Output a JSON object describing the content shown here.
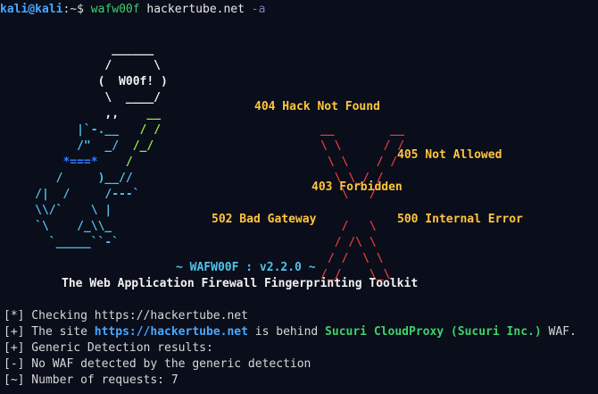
{
  "prompt": {
    "user": "kali@kali",
    "path": ":~$",
    "command": "wafw00f",
    "argument": "hackertube.net",
    "flag": "-a"
  },
  "errors": {
    "e404": "404 Hack Not Found",
    "e405": "405 Not Allowed",
    "e403": "403 Forbidden",
    "e502": "502 Bad Gateway",
    "e500": "500 Internal Error"
  },
  "banner": {
    "version_line": "~ WAFW00F : v2.2.0 ~",
    "subtitle": "The Web Application Firewall Fingerprinting Toolkit"
  },
  "output": {
    "line1_tag": "[*]",
    "line1_text": " Checking https://hackertube.net",
    "line2_tag": "[+]",
    "line2_pre": " The site ",
    "line2_url": "https://hackertube.net",
    "line2_mid": " is behind ",
    "line2_waf": "Sucuri CloudProxy (Sucuri Inc.)",
    "line2_post": " WAF.",
    "line3": "[+] Generic Detection results:",
    "line4": "[-] No WAF detected by the generic detection",
    "line5": "[~] Number of requests: 7"
  },
  "colors": {
    "background": "#0a0d1a",
    "prompt_user": "#4aa8ff",
    "command": "#3fd06a",
    "error_text": "#ffc53d",
    "x_mark": "#e23b3b"
  }
}
